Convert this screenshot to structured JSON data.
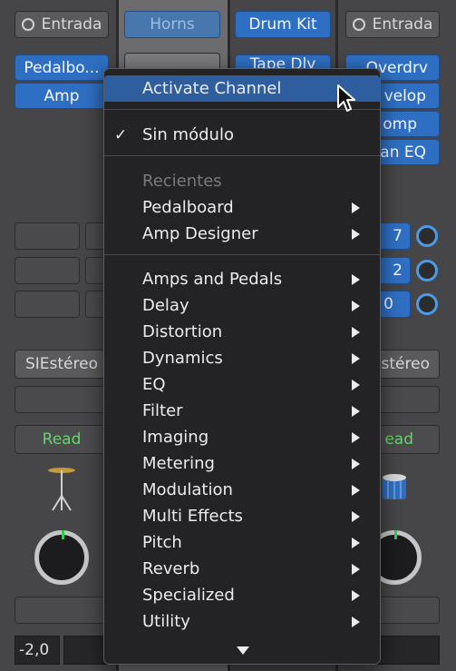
{
  "mixer": {
    "left": {
      "input_label": "Entrada",
      "plugins": [
        "Pedalbo...",
        "Amp"
      ],
      "output": "SIEstéreo",
      "automation": "Read",
      "volume": "-2,0"
    },
    "center_left": {
      "name": "Horns"
    },
    "center_right": {
      "name": "Drum Kit",
      "plugin": "Tape Dly"
    },
    "right": {
      "input_label": "Entrada",
      "plugins": [
        "Overdrv",
        "velop",
        "omp",
        "an EQ"
      ],
      "sends": [
        "7",
        "2",
        "0"
      ],
      "output": "stéreo",
      "automation": "ead"
    }
  },
  "menu": {
    "activate": "Activate Channel",
    "no_module": "Sin módulo",
    "recent_header": "Recientes",
    "recent": [
      "Pedalboard",
      "Amp Designer"
    ],
    "categories": [
      "Amps and Pedals",
      "Delay",
      "Distortion",
      "Dynamics",
      "EQ",
      "Filter",
      "Imaging",
      "Metering",
      "Modulation",
      "Multi Effects",
      "Pitch",
      "Reverb",
      "Specialized",
      "Utility"
    ]
  },
  "colors": {
    "highlight": "#2f5e9e",
    "accent_blue": "#2f6fc3",
    "read_green": "#66d56a"
  }
}
